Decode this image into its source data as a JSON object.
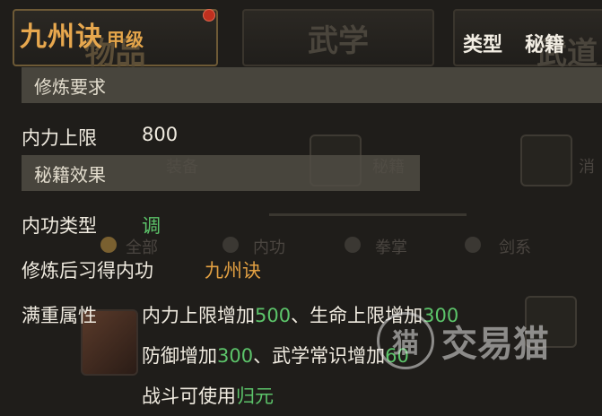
{
  "background": {
    "tabs": [
      "物品",
      "武学",
      "武道"
    ],
    "filters": [
      "装备",
      "秘籍",
      "消"
    ],
    "categories": [
      "全部",
      "内功",
      "拳掌",
      "剑系"
    ]
  },
  "header": {
    "title": "九州诀",
    "grade": "甲级",
    "type_label": "类型",
    "type_value": "秘籍"
  },
  "sections": {
    "requirement": "修炼要求",
    "effect": "秘籍效果"
  },
  "rows": {
    "neili_label": "内力上限",
    "neili_value": "800",
    "neigong_type_label": "内功类型",
    "neigong_type_value": "调",
    "learn_label": "修炼后习得内功",
    "learn_value": "九州诀",
    "full_label": "满重属性"
  },
  "attributes": {
    "line1_a": "内力上限增加",
    "line1_a_val": "500",
    "line1_sep": "、",
    "line1_b": "生命上限增加",
    "line1_b_val": "300",
    "line2_a": "防御增加",
    "line2_a_val": "300",
    "line2_sep": "、",
    "line2_b": "武学常识增加",
    "line2_b_val": "60",
    "line3_a": "战斗可使用",
    "line3_a_val": "归元"
  },
  "watermark": {
    "text": "交易猫",
    "logo_glyph": "猫"
  },
  "colors": {
    "title": "#e8a84e",
    "value_green": "#5cc46a",
    "value_orange": "#e2a042"
  }
}
